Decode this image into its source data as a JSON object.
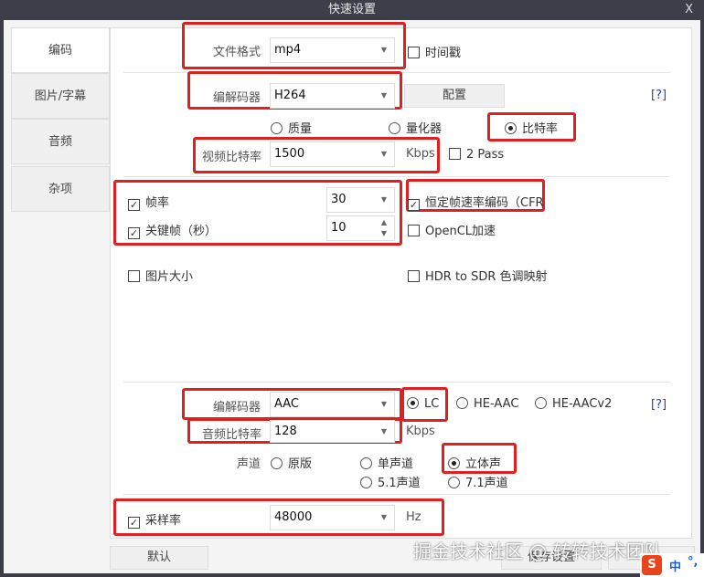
{
  "window": {
    "title": "快速设置",
    "close": "X"
  },
  "tabs": [
    {
      "label": "编码"
    },
    {
      "label": "图片/字幕"
    },
    {
      "label": "音频"
    },
    {
      "label": "杂项"
    }
  ],
  "video": {
    "format_label": "文件格式",
    "format_value": "mp4",
    "timestamp_label": "时间戳",
    "codec_label": "编解码器",
    "codec_value": "H264",
    "config_button": "配置",
    "help": "[?]",
    "mode_options": [
      "质量",
      "量化器",
      "比特率"
    ],
    "mode_selected": "比特率",
    "bitrate_label": "视频比特率",
    "bitrate_value": "1500",
    "bitrate_unit": "Kbps",
    "twopass_label": "2 Pass",
    "framerate_label": "帧率",
    "framerate_value": "30",
    "keyframe_label": "关键帧（秒）",
    "keyframe_value": "10",
    "cfr_label": "恒定帧速率编码（CFR",
    "opencl_label": "OpenCL加速",
    "picsize_label": "图片大小",
    "hdr_label": "HDR to SDR 色调映射"
  },
  "audio": {
    "codec_label": "编解码器",
    "codec_value": "AAC",
    "profiles": [
      "LC",
      "HE-AAC",
      "HE-AACv2"
    ],
    "profile_selected": "LC",
    "help": "[?]",
    "bitrate_label": "音频比特率",
    "bitrate_value": "128",
    "bitrate_unit": "Kbps",
    "channel_label": "声道",
    "channels": [
      "原版",
      "单声道",
      "立体声",
      "5.1声道",
      "7.1声道"
    ],
    "channel_selected": "立体声",
    "samplerate_label": "采样率",
    "samplerate_value": "48000",
    "samplerate_unit": "Hz"
  },
  "footer": {
    "default_button": "默认",
    "save_button": "保存设置"
  },
  "watermark": "掘金技术社区 @ 转转技术团队",
  "ime": {
    "logo": "S",
    "lang": "中",
    "punct": "°,"
  }
}
